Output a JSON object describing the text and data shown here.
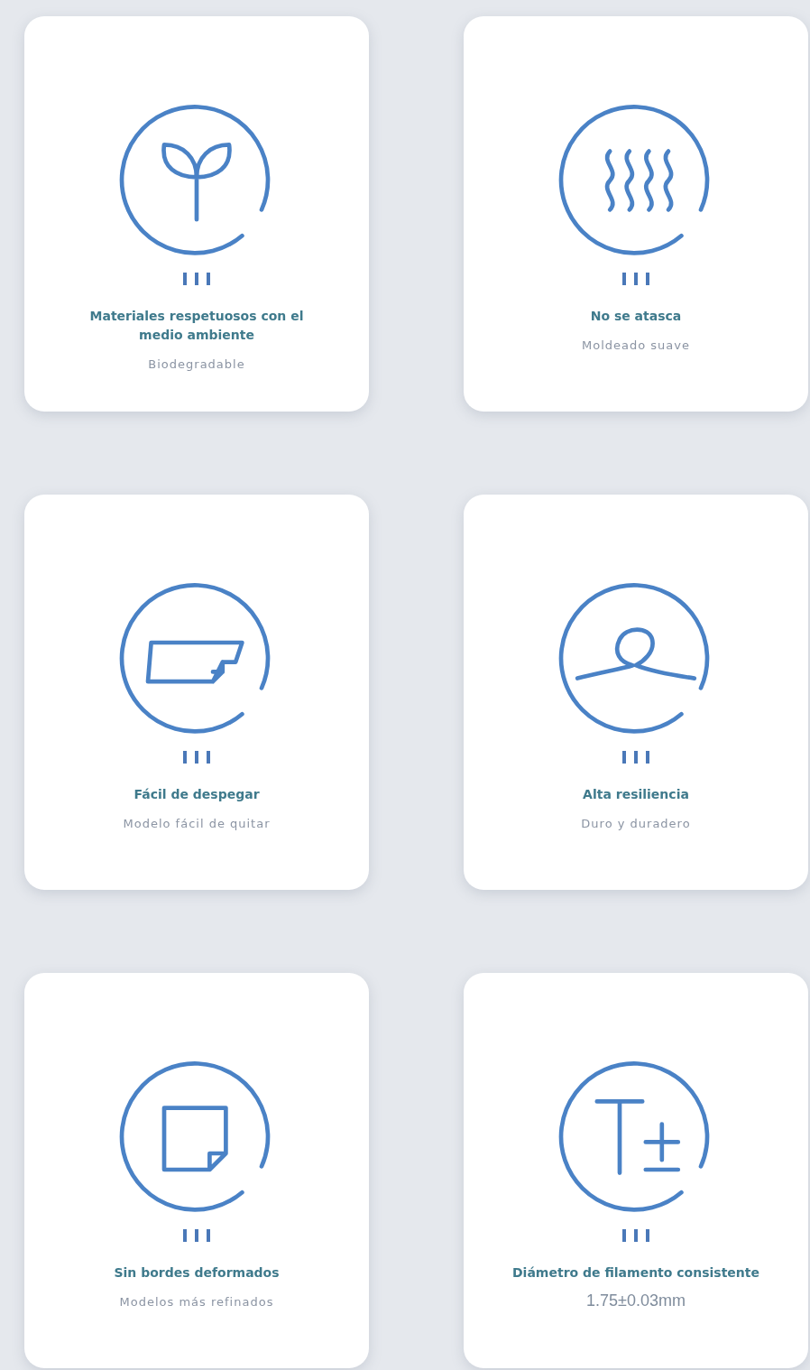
{
  "features": [
    {
      "kind": "sprout",
      "title": "Materiales respetuosos con el medio ambiente",
      "subtitle": {
        "kind": "tagline",
        "text": "Biodegradable"
      }
    },
    {
      "kind": "steam",
      "title": "No se atasca",
      "subtitle": {
        "kind": "tagline",
        "text": "Moldeado suave"
      }
    },
    {
      "kind": "sheet",
      "title": "Fácil de despegar",
      "subtitle": {
        "kind": "tagline",
        "text": "Modelo fácil de quitar"
      }
    },
    {
      "kind": "loop",
      "title": "Alta resiliencia",
      "subtitle": {
        "kind": "tagline",
        "text": "Duro y duradero"
      }
    },
    {
      "kind": "note",
      "title": "Sin bordes deformados",
      "subtitle": {
        "kind": "tagline",
        "text": "Modelos más refinados"
      }
    },
    {
      "kind": "tolerance",
      "title": "Diámetro de filamento consistente",
      "subtitle": {
        "kind": "value",
        "text": "1.75±0.03mm"
      }
    }
  ]
}
